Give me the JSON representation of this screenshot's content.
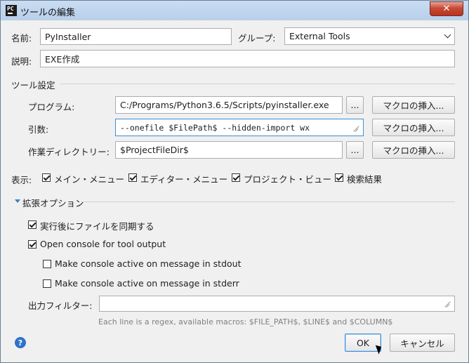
{
  "window": {
    "title": "ツールの編集",
    "app_icon_text": "PC",
    "close_glyph": "✕"
  },
  "form": {
    "name_label": "名前:",
    "name_value": "PyInstaller",
    "group_label": "グループ:",
    "group_value": "External Tools",
    "description_label": "説明:",
    "description_value": "EXE作成"
  },
  "tool_settings": {
    "section_label": "ツール設定",
    "program_label": "プログラム:",
    "program_value": "C:/Programs/Python3.6.5/Scripts/pyinstaller.exe",
    "arguments_label": "引数:",
    "arguments_value": "--onefile $FilePath$ --hidden-import wx",
    "workdir_label": "作業ディレクトリー:",
    "workdir_value": "$ProjectFileDir$",
    "browse_label": "...",
    "insert_macro_label": "マクロの挿入..."
  },
  "display": {
    "label": "表示:",
    "options": [
      {
        "label": "メイン・メニュー",
        "checked": true
      },
      {
        "label": "エディター・メニュー",
        "checked": true
      },
      {
        "label": "プロジェクト・ビュー",
        "checked": true
      },
      {
        "label": "検索結果",
        "checked": true
      }
    ]
  },
  "advanced": {
    "section_label": "拡張オプション",
    "sync_after": {
      "label": "実行後にファイルを同期する",
      "checked": true
    },
    "open_console": {
      "label": "Open console for tool output",
      "checked": true
    },
    "active_stdout": {
      "label": "Make console active on message in stdout",
      "checked": false
    },
    "active_stderr": {
      "label": "Make console active on message in stderr",
      "checked": false
    },
    "output_filters_label": "出力フィルター:",
    "output_filters_value": "",
    "hint": "Each line is a regex, available macros: $FILE_PATH$, $LINE$ and $COLUMN$"
  },
  "footer": {
    "help_glyph": "?",
    "ok_label": "OK",
    "cancel_label": "キャンセル"
  }
}
